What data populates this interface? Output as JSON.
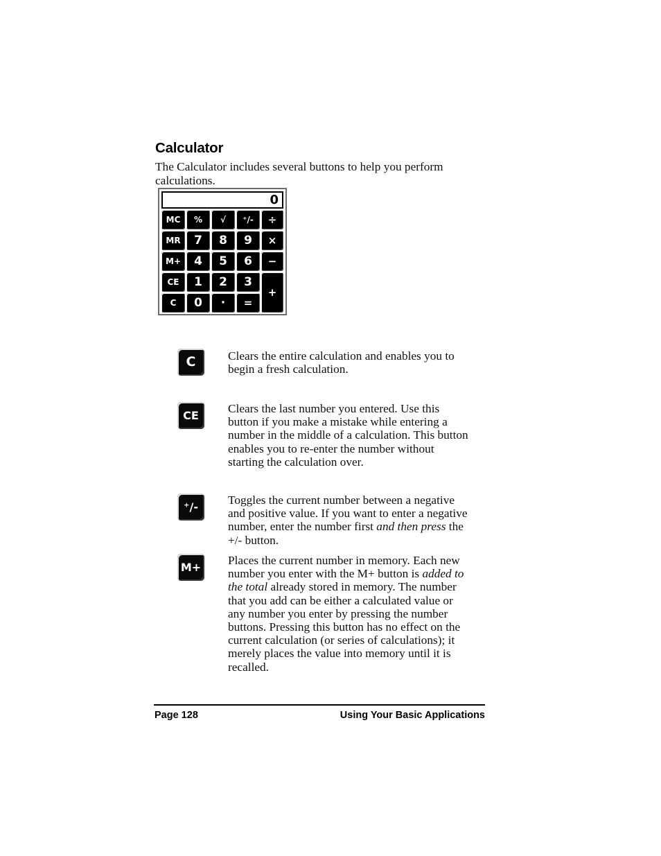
{
  "page": {
    "heading": "Calculator",
    "intro": "The Calculator includes several buttons to help you perform calculations."
  },
  "calculator": {
    "display_value": "0",
    "keys": [
      {
        "name": "memory-clear",
        "label": "MC",
        "kind": "fn"
      },
      {
        "name": "percent",
        "label": "%",
        "kind": "fn"
      },
      {
        "name": "square-root",
        "label": "√",
        "kind": "fn"
      },
      {
        "name": "plus-minus",
        "label": "⁺/-",
        "kind": "fn"
      },
      {
        "name": "divide",
        "label": "÷",
        "kind": "op"
      },
      {
        "name": "memory-recall",
        "label": "MR",
        "kind": "fn"
      },
      {
        "name": "digit-7",
        "label": "7",
        "kind": "num"
      },
      {
        "name": "digit-8",
        "label": "8",
        "kind": "num"
      },
      {
        "name": "digit-9",
        "label": "9",
        "kind": "num"
      },
      {
        "name": "multiply",
        "label": "×",
        "kind": "op"
      },
      {
        "name": "memory-add",
        "label": "M+",
        "kind": "fn"
      },
      {
        "name": "digit-4",
        "label": "4",
        "kind": "num"
      },
      {
        "name": "digit-5",
        "label": "5",
        "kind": "num"
      },
      {
        "name": "digit-6",
        "label": "6",
        "kind": "num"
      },
      {
        "name": "subtract",
        "label": "−",
        "kind": "op"
      },
      {
        "name": "clear-entry",
        "label": "CE",
        "kind": "fn"
      },
      {
        "name": "digit-1",
        "label": "1",
        "kind": "num"
      },
      {
        "name": "digit-2",
        "label": "2",
        "kind": "num"
      },
      {
        "name": "digit-3",
        "label": "3",
        "kind": "num"
      },
      {
        "name": "add",
        "label": "+",
        "kind": "op"
      },
      {
        "name": "clear-all",
        "label": "C",
        "kind": "fn"
      },
      {
        "name": "digit-0",
        "label": "0",
        "kind": "num"
      },
      {
        "name": "decimal-point",
        "label": "·",
        "kind": "num"
      },
      {
        "name": "equals",
        "label": "=",
        "kind": "op"
      }
    ]
  },
  "definitions": [
    {
      "key_name": "clear-all",
      "key_label": "C",
      "key_size": "sz-lg",
      "text_parts": [
        {
          "style": "normal",
          "text": "Clears the entire calculation and enables you to begin a fresh calculation."
        }
      ]
    },
    {
      "key_name": "clear-entry",
      "key_label": "CE",
      "key_size": "sz-md",
      "text_parts": [
        {
          "style": "normal",
          "text": "Clears the last number you entered. Use this button if you make a mistake while entering a number in the middle of a calculation. This button enables you to re-enter the number without starting the calculation over."
        }
      ]
    },
    {
      "key_name": "plus-minus",
      "key_label": "⁺/-",
      "key_size": "sz-md",
      "text_parts": [
        {
          "style": "normal",
          "text": "Toggles the current number between a negative and positive value. If you want to enter a negative number, enter the number first "
        },
        {
          "style": "italic",
          "text": "and then press"
        },
        {
          "style": "normal",
          "text": " the +/- button."
        }
      ]
    },
    {
      "key_name": "memory-add",
      "key_label": "M+",
      "key_size": "sz-md",
      "text_parts": [
        {
          "style": "normal",
          "text": "Places the current number in memory. Each new number you enter with the M+ button is "
        },
        {
          "style": "italic",
          "text": "added to the total"
        },
        {
          "style": "normal",
          "text": " already stored in memory. The number that you add can be either a calculated value or any number you enter by pressing the number buttons. Pressing this button has no effect on the current calculation (or series of calculations); it merely places the value into memory until it is recalled."
        }
      ]
    }
  ],
  "footer": {
    "page_number": "Page 128",
    "section_title": "Using Your Basic Applications"
  }
}
